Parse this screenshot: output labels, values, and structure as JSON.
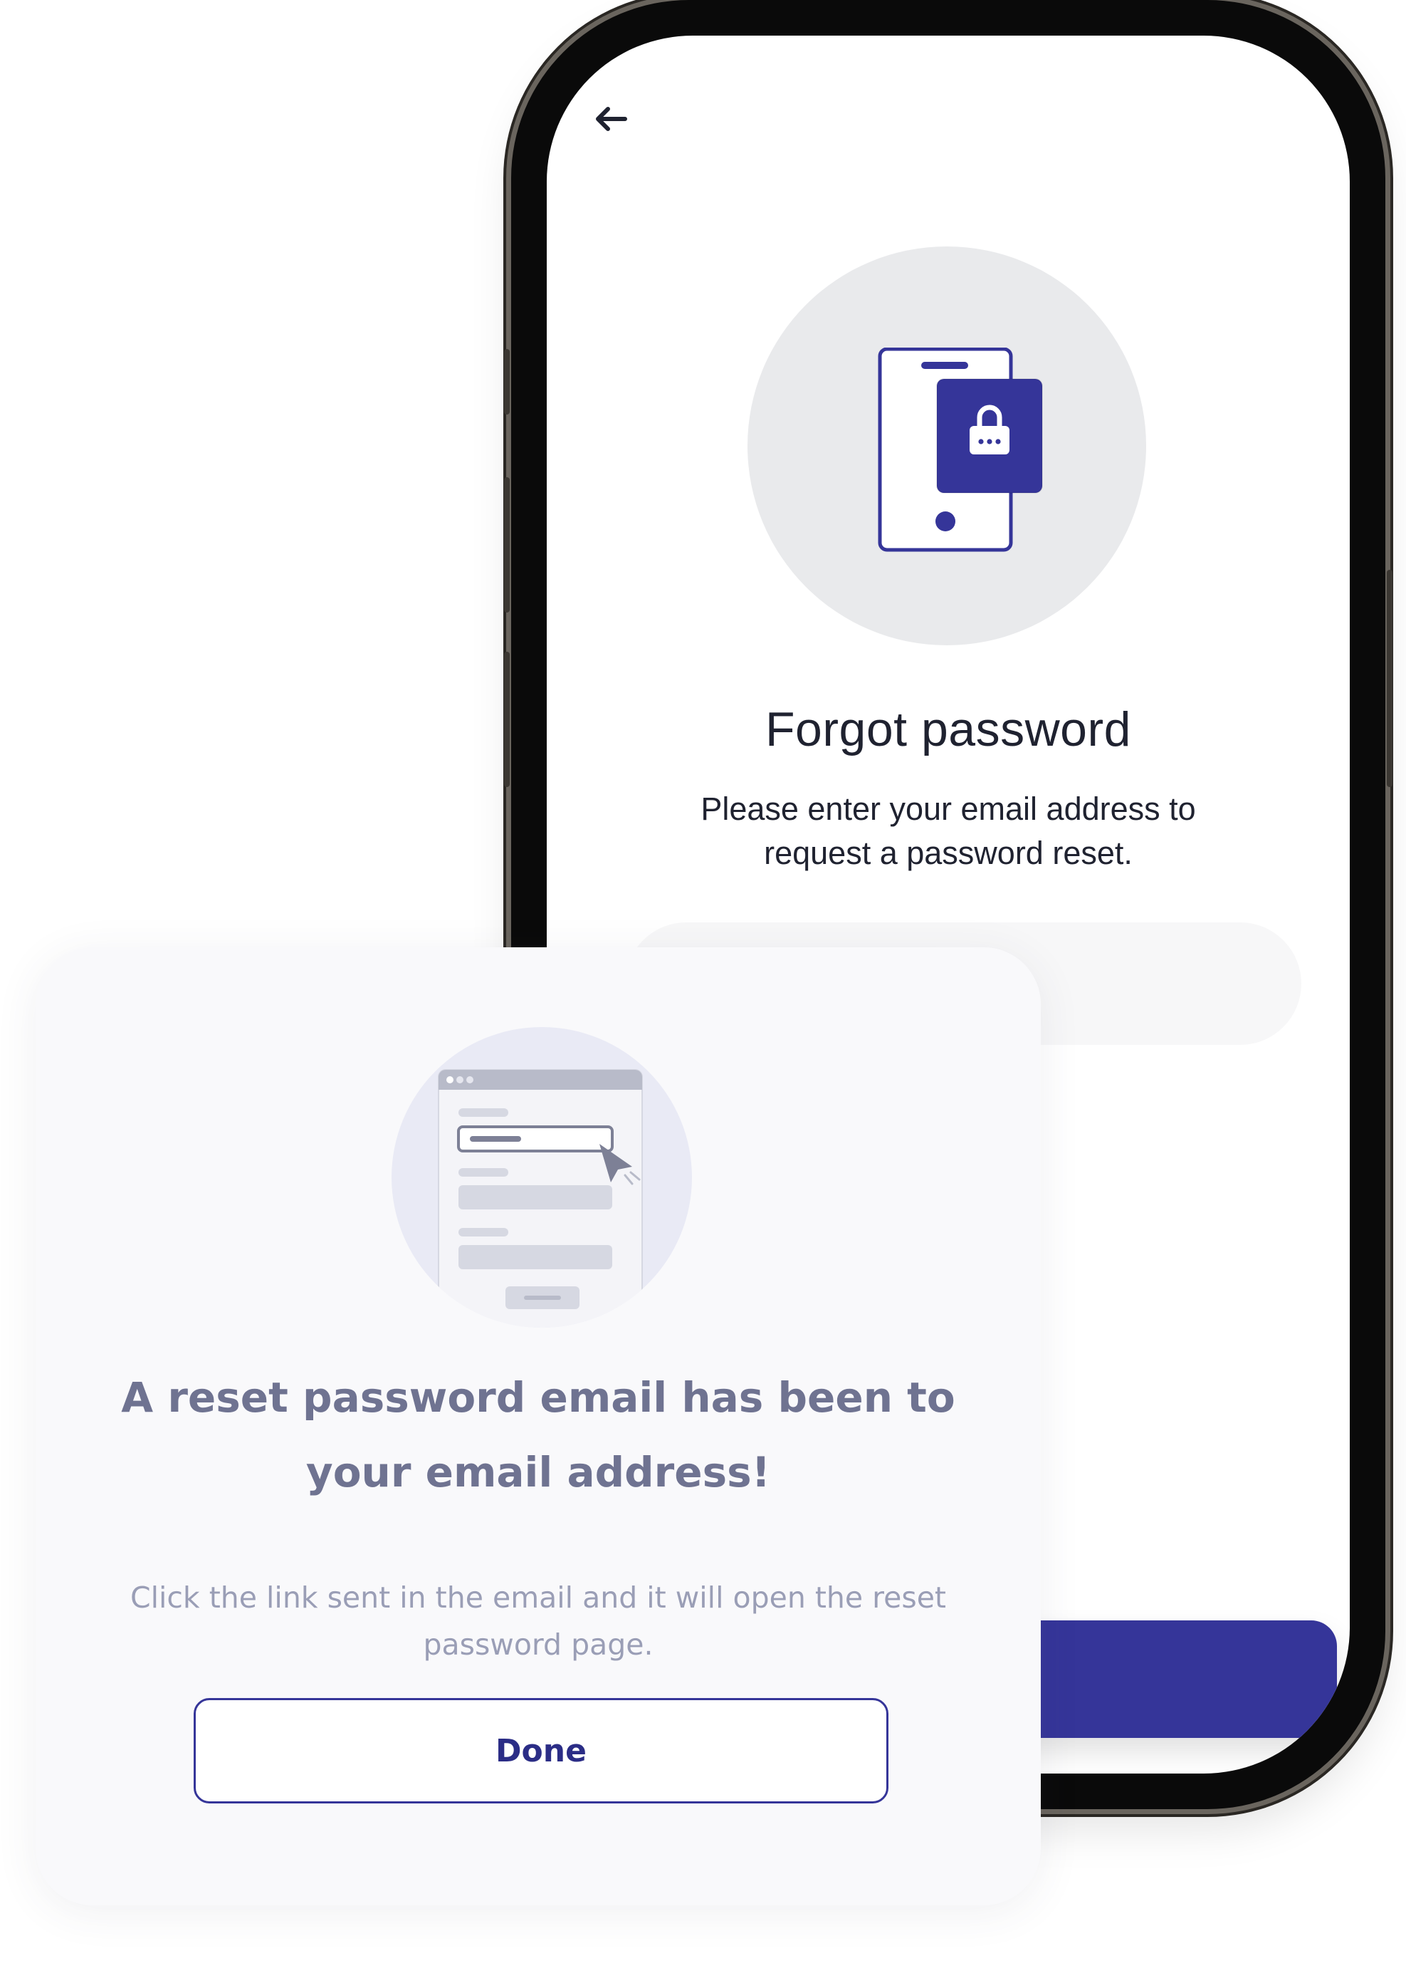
{
  "phone_screen": {
    "back_icon": "arrow-left-icon",
    "hero_icon": "phone-lock-icon",
    "title": "Forgot password",
    "description": "Please enter your email address to request a password reset.",
    "email_placeholder": "",
    "submit_label": ""
  },
  "card": {
    "illustration_icon": "browser-form-cursor-icon",
    "title": "A reset password email has been to your email address!",
    "description": "Click the link sent in the email and it will open the reset password page.",
    "done_label": "Done"
  },
  "colors": {
    "accent": "#353599",
    "card_title": "#6f7391",
    "card_desc": "#9a9eb6",
    "hero_circle": "#e9eaec"
  }
}
